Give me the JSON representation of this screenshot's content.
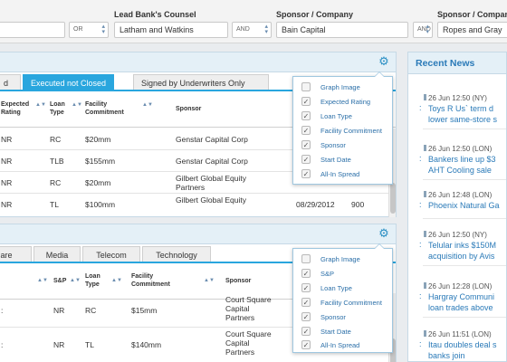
{
  "filters": {
    "label_lead_bank": "Lead Bank's Counsel",
    "label_sponsor": "Sponsor / Company",
    "label_sponsor2": "Sponsor / Company",
    "op1": "OR",
    "lead_bank_value": "Latham and Watkins",
    "op2": "AND",
    "sponsor_value": "Bain Capital",
    "op3": "AND",
    "sponsor2_value": "Ropes and Gray"
  },
  "panel1": {
    "tabs": [
      "d",
      "Executed not Closed",
      "Signed by Underwriters Only"
    ],
    "columns": {
      "expected_rating": "Expected Rating",
      "loan_type": "Loan Type",
      "facility_commitment": "Facility Commitment",
      "sponsor": "Sponsor"
    },
    "rows": [
      {
        "rating": "NR",
        "loan_type": "RC",
        "commitment": "$20mm",
        "sponsor": "Genstar Capital Corp",
        "date": "",
        "spread": ""
      },
      {
        "rating": "NR",
        "loan_type": "TLB",
        "commitment": "$155mm",
        "sponsor": "Genstar Capital Corp",
        "date": "",
        "spread": ""
      },
      {
        "rating": "NR",
        "loan_type": "RC",
        "commitment": "$20mm",
        "sponsor": "Gilbert Global Equity Partners",
        "date": "",
        "spread": ""
      },
      {
        "rating": "NR",
        "loan_type": "TL",
        "commitment": "$100mm",
        "sponsor": "Gilbert Global Equity",
        "date": "08/29/2012",
        "spread": "900"
      }
    ],
    "column_chooser": [
      {
        "label": "Graph Image",
        "checked": false
      },
      {
        "label": "Expected Rating",
        "checked": true
      },
      {
        "label": "Loan Type",
        "checked": true
      },
      {
        "label": "Facility Commitment",
        "checked": true
      },
      {
        "label": "Sponsor",
        "checked": true
      },
      {
        "label": "Start Date",
        "checked": true
      },
      {
        "label": "All-In Spread",
        "checked": true
      }
    ]
  },
  "panel2": {
    "tabs": [
      "Care",
      "Media",
      "Telecom",
      "Technology"
    ],
    "columns": {
      "sp": "S&P",
      "loan_type": "Loan Type",
      "facility_commitment": "Facility Commitment",
      "sponsor": "Sponsor"
    },
    "rows": [
      {
        "first": ":",
        "sp": "NR",
        "loan_type": "RC",
        "commitment": "$15mm",
        "sponsor": "Court Square Capital Partners"
      },
      {
        "first": ":",
        "sp": "NR",
        "loan_type": "TL",
        "commitment": "$140mm",
        "sponsor": "Court Square Capital Partners"
      }
    ],
    "column_chooser": [
      {
        "label": "Graph Image",
        "checked": false
      },
      {
        "label": "S&P",
        "checked": true
      },
      {
        "label": "Loan Type",
        "checked": true
      },
      {
        "label": "Facility Commitment",
        "checked": true
      },
      {
        "label": "Sponsor",
        "checked": true
      },
      {
        "label": "Start Date",
        "checked": true
      },
      {
        "label": "All-In Spread",
        "checked": true
      }
    ]
  },
  "news": {
    "title": "Recent News",
    "items": [
      {
        "time": "26 Jun 12:50 (NY)",
        "line1": "Toys R Us` term d",
        "line2": "lower same-store s"
      },
      {
        "time": "26 Jun 12:50 (LON)",
        "line1": "Bankers line up $3",
        "line2": "AHT Cooling sale"
      },
      {
        "time": "26 Jun 12:48 (LON)",
        "line1": "Phoenix Natural Ga",
        "line2": ""
      },
      {
        "time": "26 Jun 12:50 (NY)",
        "line1": "Telular inks $150M",
        "line2": "acquisition by Avis"
      },
      {
        "time": "26 Jun 12:28 (LON)",
        "line1": "Hargray Communi",
        "line2": "loan trades above"
      },
      {
        "time": "26 Jun 11:51 (LON)",
        "line1": "Itau doubles deal s",
        "line2": "banks join"
      }
    ]
  },
  "colors": {
    "accent": "#29a6de",
    "link": "#2a7ab8",
    "header_bg": "#e4f0f7"
  }
}
